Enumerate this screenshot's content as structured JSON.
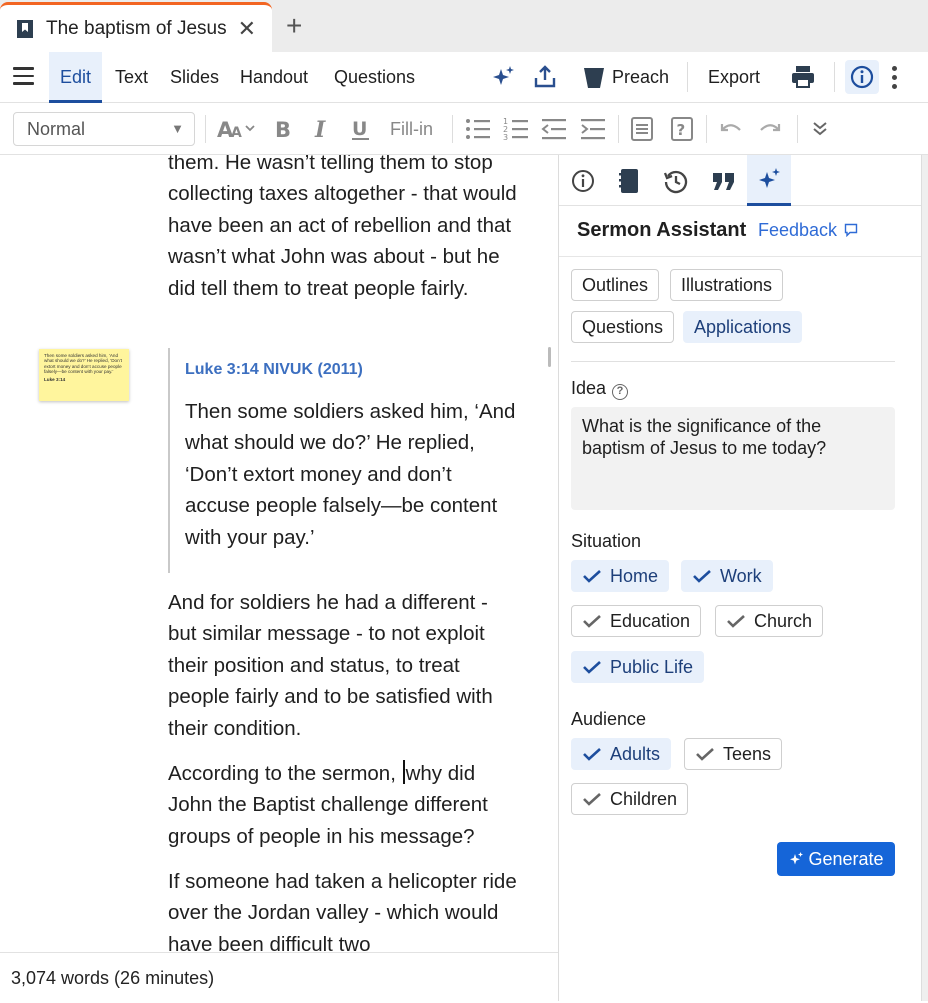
{
  "tab": {
    "title": "The baptism of Jesus",
    "close": "✕",
    "new": "+"
  },
  "menu": {
    "items": [
      "Edit",
      "Text",
      "Slides",
      "Handout",
      "Questions"
    ],
    "preach": "Preach",
    "export": "Export"
  },
  "toolbar": {
    "style": "Normal",
    "fillin": "Fill-in"
  },
  "document": {
    "para1": "them. He wasn’t telling them to stop collecting taxes altogether - that would have been an act of rebellion and that wasn’t what John was about - but he did tell them to treat people fairly.",
    "quote_ref": "Luke 3:14 NIVUK (2011)",
    "quote_text": "Then some soldiers asked him, ‘And what should we do?’ He replied, ‘Don’t extort money and don’t accuse people falsely—be content with your pay.’",
    "sticky_text": "Then some soldiers asked him, ‘And what should we do?’ He replied, ‘Don’t extort money and don’t accuse people falsely—be content with your pay.’",
    "sticky_ref": "Luke 3:14",
    "para2": "And for soldiers he had a different - but similar message - to not exploit their position and status, to treat people fairly and to be satisfied with their condition.",
    "para3_before": "According to the sermon, ",
    "para3_after": "why did John the Baptist challenge different groups of people in his message?",
    "para4": "If someone had taken a helicopter ride over the Jordan valley - which would have been difficult two"
  },
  "status": {
    "wordcount": "3,074 words (26 minutes)"
  },
  "panel": {
    "title": "Sermon Assistant",
    "feedback": "Feedback",
    "modes": [
      {
        "label": "Outlines",
        "selected": false
      },
      {
        "label": "Illustrations",
        "selected": false
      },
      {
        "label": "Questions",
        "selected": false
      },
      {
        "label": "Applications",
        "selected": true
      }
    ],
    "idea_label": "Idea",
    "idea_help": "?",
    "idea_text": "What is the significance of the baptism of Jesus to me today?",
    "situation_label": "Situation",
    "situation": [
      {
        "label": "Home",
        "selected": true
      },
      {
        "label": "Work",
        "selected": true
      },
      {
        "label": "Education",
        "selected": false
      },
      {
        "label": "Church",
        "selected": false
      },
      {
        "label": "Public Life",
        "selected": true
      }
    ],
    "audience_label": "Audience",
    "audience": [
      {
        "label": "Adults",
        "selected": true
      },
      {
        "label": "Teens",
        "selected": false
      },
      {
        "label": "Children",
        "selected": false
      }
    ],
    "generate": "Generate"
  },
  "colors": {
    "accent": "#1d4e9e",
    "link": "#2f6bd6",
    "button": "#1565d8",
    "chip_selected": "#e8f0fb",
    "tab_accent": "#f26522"
  }
}
